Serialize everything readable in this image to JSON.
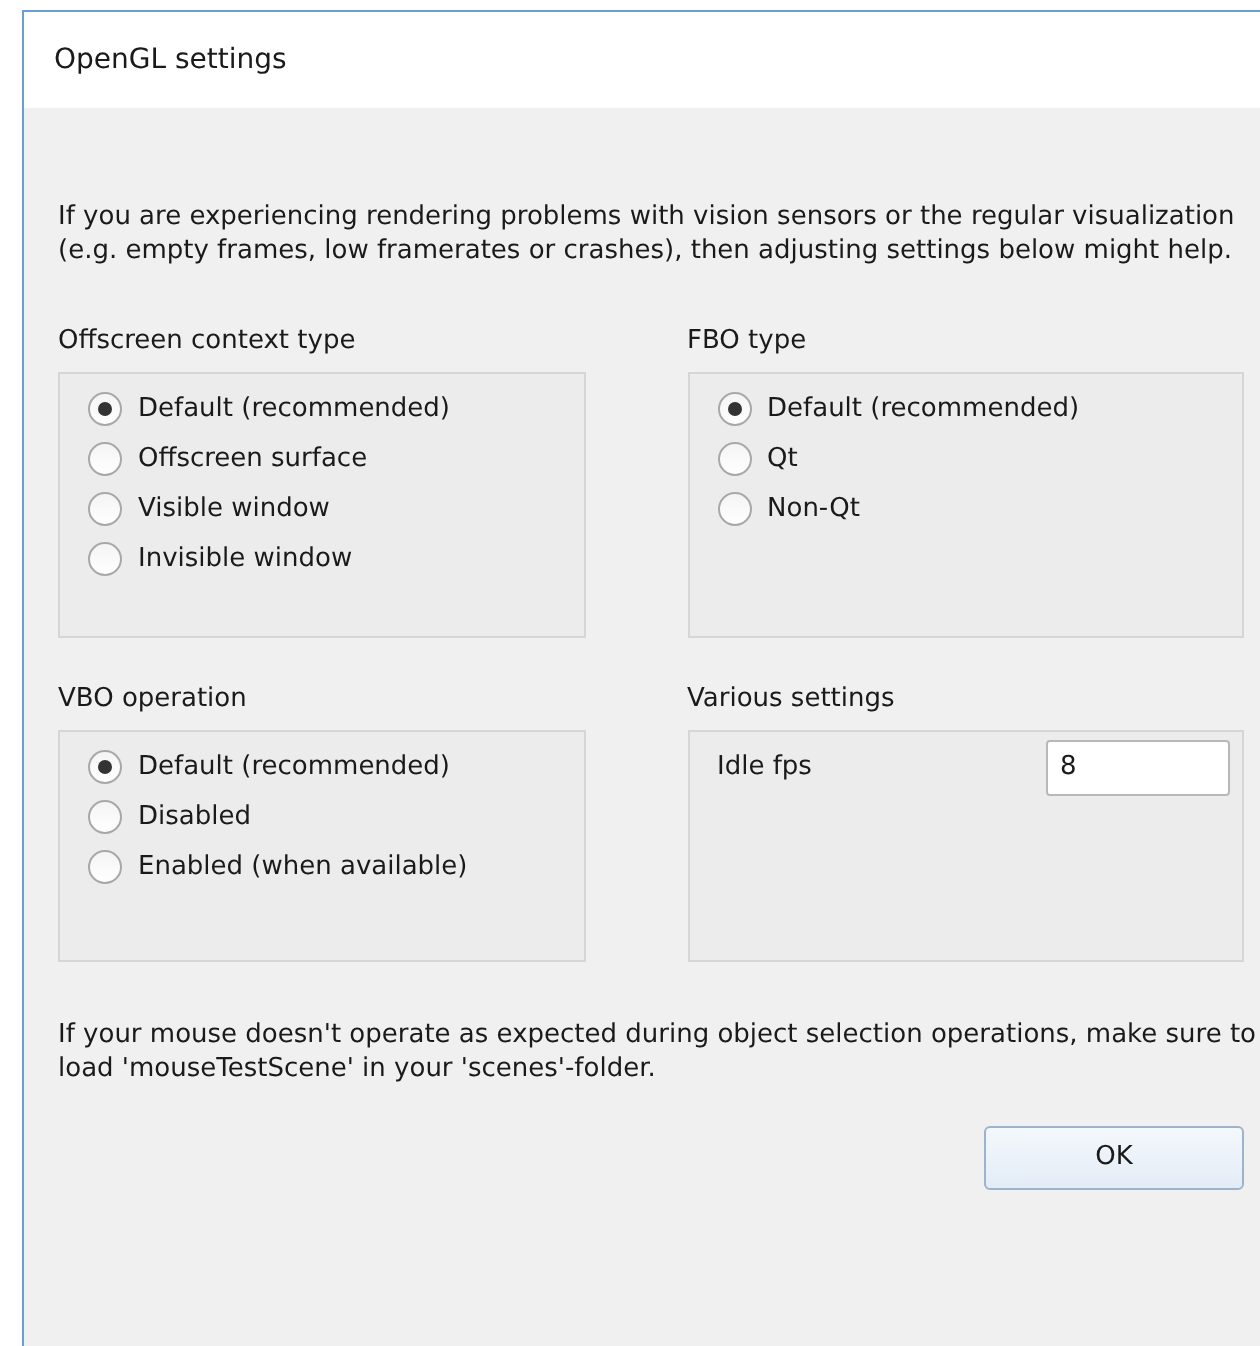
{
  "window": {
    "title": "OpenGL settings"
  },
  "intro": "If you are experiencing rendering problems with vision sensors or the regular visualization (e.g. empty frames, low framerates or crashes), then adjusting settings below might help.",
  "groups": [
    {
      "kind": "radio",
      "title": "Offscreen context type",
      "options": [
        {
          "label": "Default (recommended)",
          "selected": true
        },
        {
          "label": "Offscreen surface",
          "selected": false
        },
        {
          "label": "Visible window",
          "selected": false
        },
        {
          "label": "Invisible window",
          "selected": false
        }
      ]
    },
    {
      "kind": "radio",
      "title": "FBO type",
      "options": [
        {
          "label": "Default (recommended)",
          "selected": true
        },
        {
          "label": "Qt",
          "selected": false
        },
        {
          "label": "Non-Qt",
          "selected": false
        }
      ]
    },
    {
      "kind": "radio",
      "title": "VBO operation",
      "options": [
        {
          "label": "Default (recommended)",
          "selected": true
        },
        {
          "label": "Disabled",
          "selected": false
        },
        {
          "label": "Enabled (when available)",
          "selected": false
        }
      ]
    },
    {
      "kind": "fields",
      "title": "Various settings",
      "fields": [
        {
          "label": "Idle fps",
          "value": "8"
        }
      ]
    }
  ],
  "note": "If your mouse doesn't operate as expected during object selection operations, make sure to load 'mouseTestScene' in your 'scenes'-folder.",
  "buttons": [
    "OK"
  ]
}
